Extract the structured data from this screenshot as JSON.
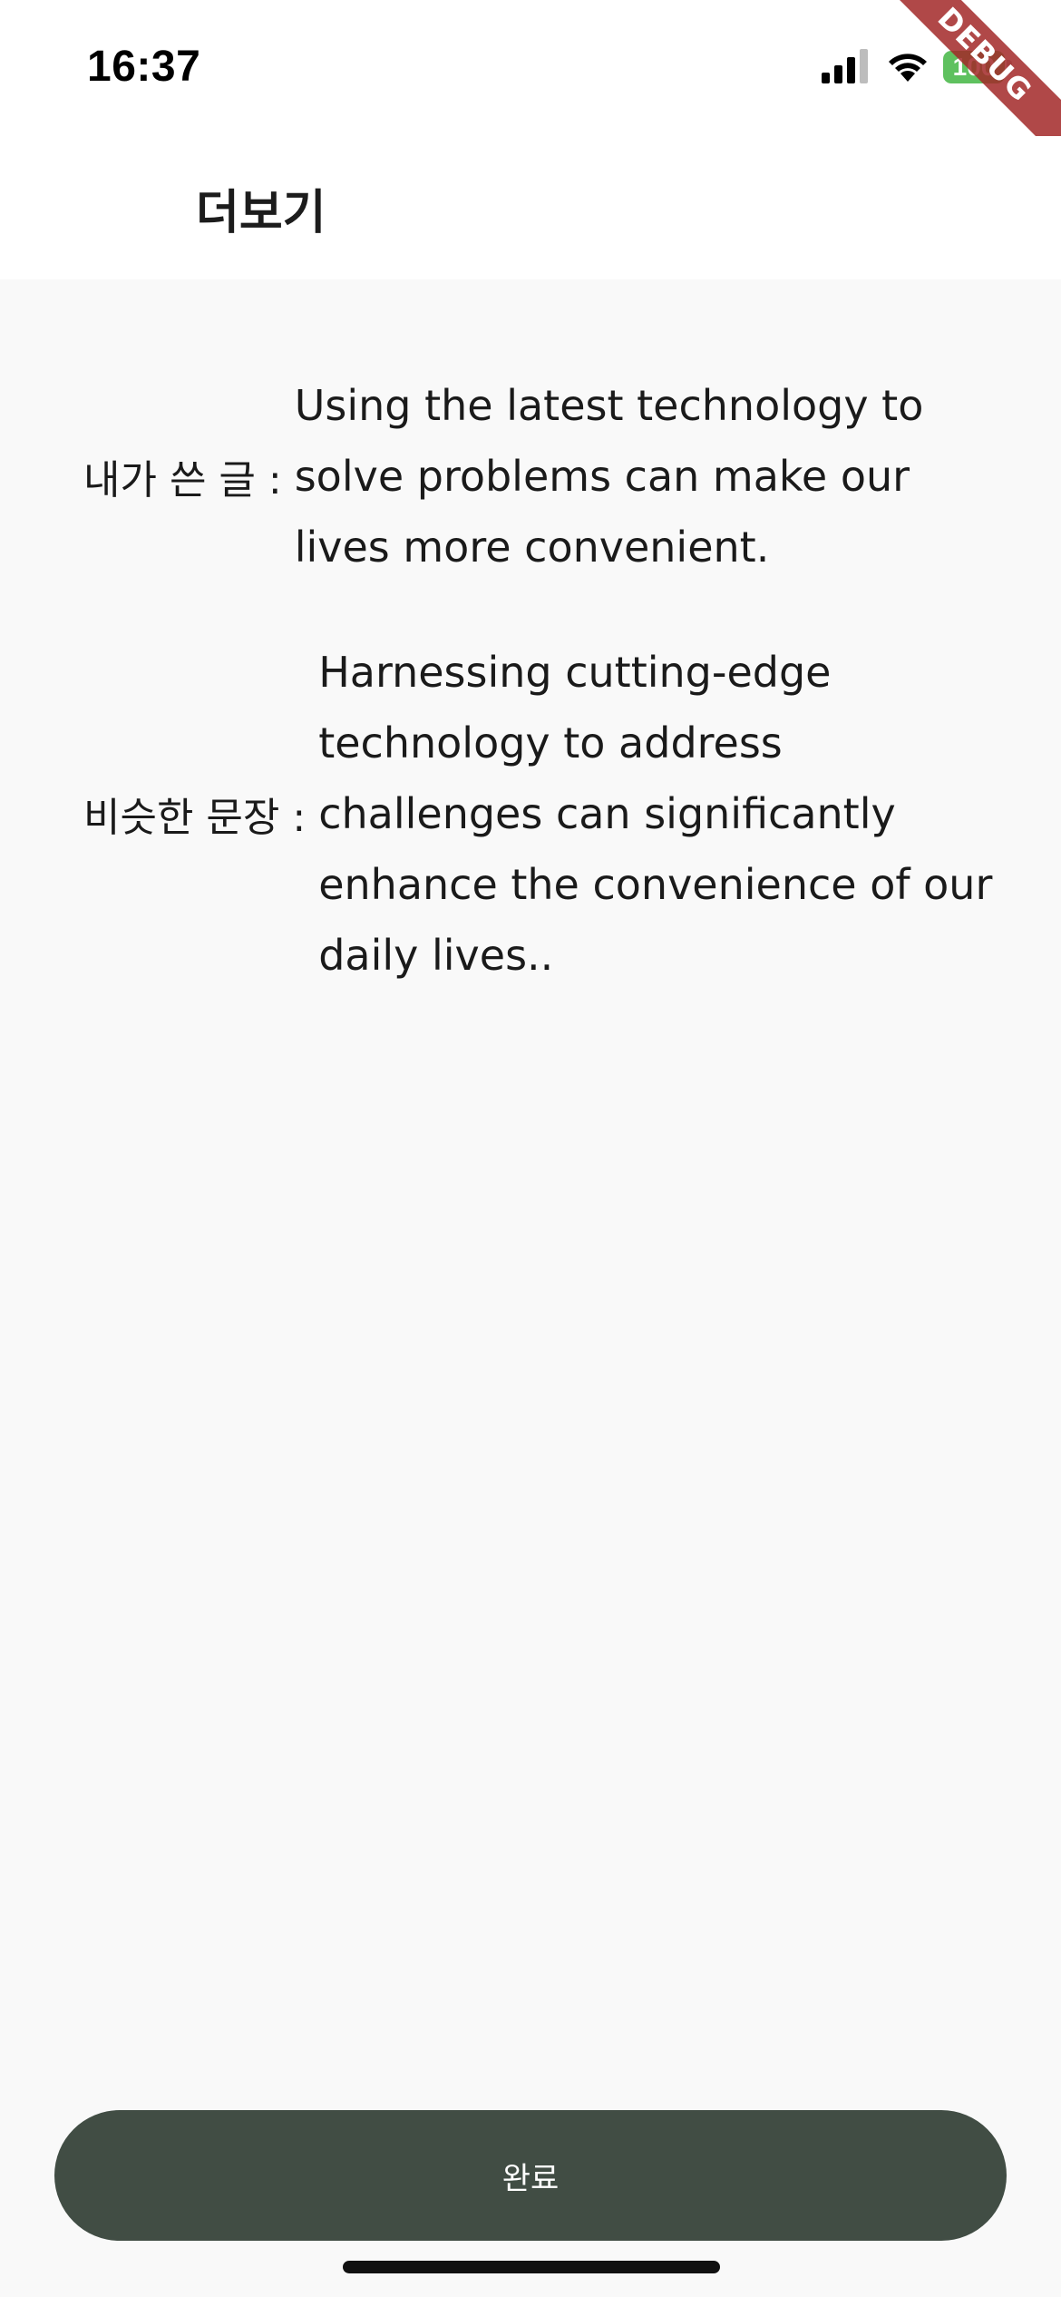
{
  "status_bar": {
    "time": "16:37",
    "battery_level": "100",
    "battery_color": "#5fc15f"
  },
  "debug_banner": "DEBUG",
  "app_bar": {
    "title": "더보기"
  },
  "content": {
    "my_text": {
      "label": "내가 쓴 글 :",
      "text": "Using the latest technology to solve problems can make our lives more convenient."
    },
    "similar_sentence": {
      "label": "비슷한 문장 :",
      "text": "Harnessing cutting-edge technology to address challenges can significantly enhance the convenience of our daily lives.."
    }
  },
  "footer": {
    "done_label": "완료",
    "button_color": "#414d44"
  }
}
